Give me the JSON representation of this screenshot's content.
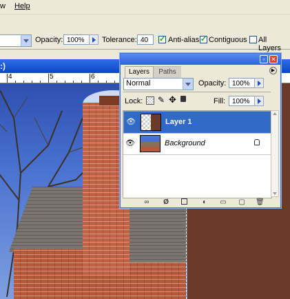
{
  "menubar": {
    "item_view": "w",
    "item_help": "Help"
  },
  "options": {
    "opacity_label": "Opacity:",
    "opacity_value": "100%",
    "tolerance_label": "Tolerance:",
    "tolerance_value": "40",
    "antialias_label": "Anti-alias",
    "antialias_checked": true,
    "contiguous_label": "Contiguous",
    "contiguous_checked": true,
    "all_layers_label": "All Layers",
    "all_layers_checked": false
  },
  "document": {
    "title_fragment": ":)"
  },
  "ruler": {
    "labels": [
      "4",
      "5",
      "6"
    ]
  },
  "layers_panel": {
    "tabs": [
      {
        "label": "Layers",
        "active": true
      },
      {
        "label": "Paths",
        "active": false
      }
    ],
    "blend_mode": "Normal",
    "opacity_label": "Opacity:",
    "opacity_value": "100%",
    "lock_label": "Lock:",
    "fill_label": "Fill:",
    "fill_value": "100%",
    "layers": [
      {
        "name": "Layer 1",
        "selected": true,
        "visible": true
      },
      {
        "name": "Background",
        "selected": false,
        "visible": true,
        "locked": true
      }
    ]
  },
  "colors": {
    "xp_blue": "#0a46c8",
    "selection_blue": "#316ac5",
    "layer_fill_brown": "#6b3a28"
  }
}
